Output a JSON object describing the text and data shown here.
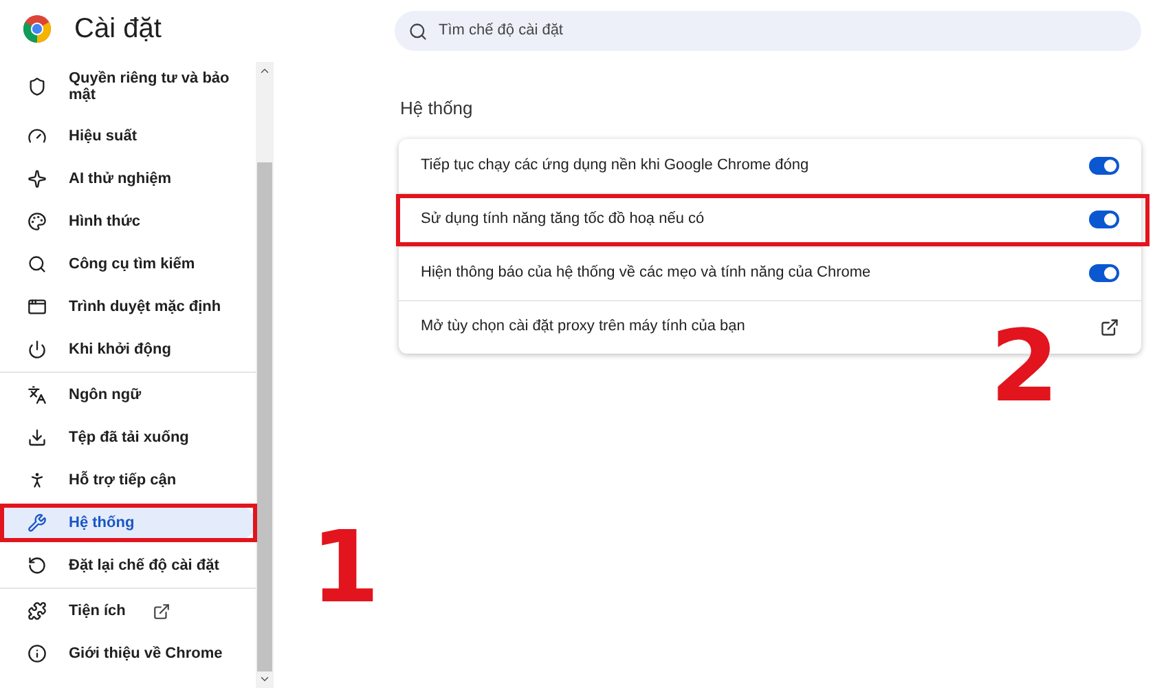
{
  "header": {
    "title": "Cài đặt"
  },
  "sidebar": {
    "groups": [
      [
        {
          "label": "Quyền riêng tư và bảo mật",
          "selected": false,
          "highlighted": false,
          "external": false
        },
        {
          "label": "Hiệu suất",
          "selected": false,
          "highlighted": false,
          "external": false
        },
        {
          "label": "AI thử nghiệm",
          "selected": false,
          "highlighted": false,
          "external": false
        },
        {
          "label": "Hình thức",
          "selected": false,
          "highlighted": false,
          "external": false
        },
        {
          "label": "Công cụ tìm kiếm",
          "selected": false,
          "highlighted": false,
          "external": false
        },
        {
          "label": "Trình duyệt mặc định",
          "selected": false,
          "highlighted": false,
          "external": false
        },
        {
          "label": "Khi khởi động",
          "selected": false,
          "highlighted": false,
          "external": false
        }
      ],
      [
        {
          "label": "Ngôn ngữ",
          "selected": false,
          "highlighted": false,
          "external": false
        },
        {
          "label": "Tệp đã tải xuống",
          "selected": false,
          "highlighted": false,
          "external": false
        },
        {
          "label": "Hỗ trợ tiếp cận",
          "selected": false,
          "highlighted": false,
          "external": false
        },
        {
          "label": "Hệ thống",
          "selected": true,
          "highlighted": true,
          "external": false
        },
        {
          "label": "Đặt lại chế độ cài đặt",
          "selected": false,
          "highlighted": false,
          "external": false
        }
      ],
      [
        {
          "label": "Tiện ích",
          "selected": false,
          "highlighted": false,
          "external": true
        },
        {
          "label": "Giới thiệu về Chrome",
          "selected": false,
          "highlighted": false,
          "external": false
        }
      ]
    ]
  },
  "search": {
    "placeholder": "Tìm chế độ cài đặt"
  },
  "section": {
    "title": "Hệ thống",
    "rows": [
      {
        "kind": "toggle",
        "label": "Tiếp tục chạy các ứng dụng nền khi Google Chrome đóng",
        "on": true,
        "highlighted": false
      },
      {
        "kind": "toggle",
        "label": "Sử dụng tính năng tăng tốc đồ hoạ nếu có",
        "on": true,
        "highlighted": true
      },
      {
        "kind": "toggle",
        "label": "Hiện thông báo của hệ thống về các mẹo và tính năng của Chrome",
        "on": true,
        "highlighted": false
      },
      {
        "kind": "link",
        "label": "Mở tùy chọn cài đặt proxy trên máy tính của bạn",
        "highlighted": false
      }
    ]
  },
  "annotations": [
    {
      "label": "1"
    },
    {
      "label": "2"
    }
  ]
}
